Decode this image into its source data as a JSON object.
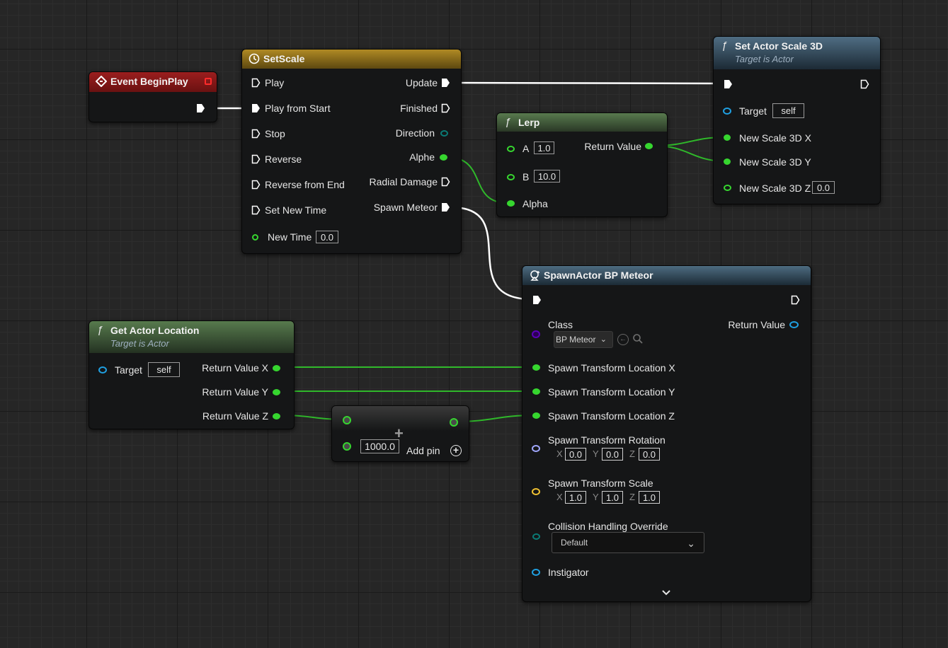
{
  "colors": {
    "exec": "#ffffff",
    "float": "#36d62f",
    "object": "#1fa0e2",
    "class": "#5b00b8",
    "rotator": "#a1a8ff",
    "vector": "#f1c232",
    "enum": "#0a7b76",
    "event_header": "#8a1414",
    "timeline_header": "#8a6b12",
    "pure_function_header": "#4c6b45",
    "function_header": "#3c5466"
  },
  "nodes": {
    "event_beginplay": {
      "title": "Event BeginPlay",
      "icon": "event-diamond-icon"
    },
    "setscale": {
      "title": "SetScale",
      "icon": "clock-icon",
      "inputs": [
        "Play",
        "Play from Start",
        "Stop",
        "Reverse",
        "Reverse from End",
        "Set New Time"
      ],
      "new_time_label": "New Time",
      "new_time_value": "0.0",
      "outputs": [
        "Update",
        "Finished",
        "Direction",
        "Alphe",
        "Radial Damage",
        "Spawn Meteor"
      ]
    },
    "set_actor_scale": {
      "title": "Set Actor Scale 3D",
      "subtitle": "Target is Actor",
      "icon": "function-icon",
      "target_label": "Target",
      "target_value": "self",
      "x_label": "New Scale 3D X",
      "y_label": "New Scale 3D Y",
      "z_label": "New Scale 3D Z",
      "z_value": "0.0"
    },
    "lerp": {
      "title": "Lerp",
      "icon": "function-icon",
      "a_label": "A",
      "a_value": "1.0",
      "b_label": "B",
      "b_value": "10.0",
      "alpha_label": "Alpha",
      "return_label": "Return Value"
    },
    "get_actor_location": {
      "title": "Get Actor Location",
      "subtitle": "Target is Actor",
      "icon": "function-icon",
      "target_label": "Target",
      "target_value": "self",
      "outputs": [
        "Return Value X",
        "Return Value Y",
        "Return Value Z"
      ]
    },
    "add": {
      "b_value": "1000.0",
      "add_pin_label": "Add pin",
      "symbol": "+"
    },
    "spawn_actor": {
      "title": "SpawnActor BP Meteor",
      "icon": "spawn-actor-icon",
      "class_label": "Class",
      "class_value": "BP Meteor",
      "return_label": "Return Value",
      "loc_x_label": "Spawn Transform Location X",
      "loc_y_label": "Spawn Transform Location Y",
      "loc_z_label": "Spawn Transform Location Z",
      "rotation_label": "Spawn Transform Rotation",
      "rotation": {
        "x": "0.0",
        "y": "0.0",
        "z": "0.0"
      },
      "scale_label": "Spawn Transform Scale",
      "scale": {
        "x": "1.0",
        "y": "1.0",
        "z": "1.0"
      },
      "collision_label": "Collision Handling Override",
      "collision_value": "Default",
      "instigator_label": "Instigator",
      "axis_x": "X",
      "axis_y": "Y",
      "axis_z": "Z"
    }
  }
}
